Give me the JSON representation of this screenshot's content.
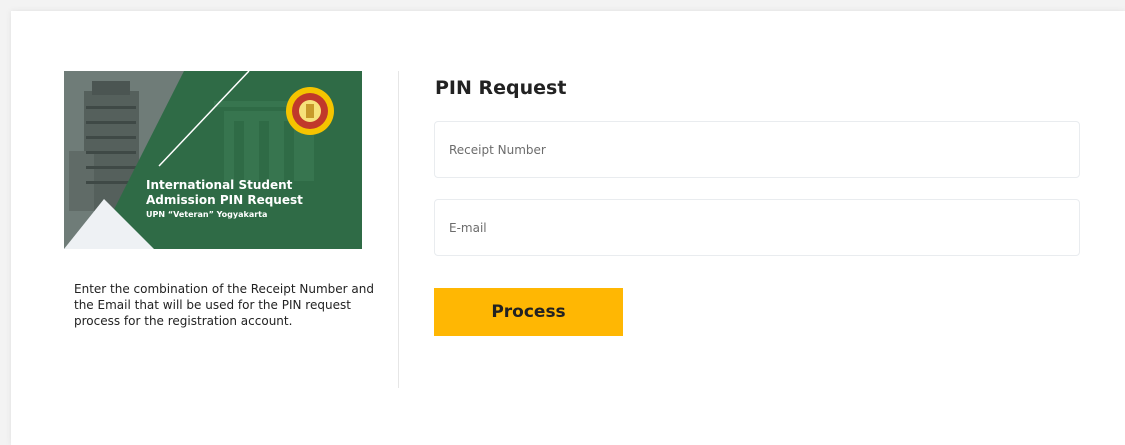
{
  "banner": {
    "title": "International Student Admission PIN Request",
    "subtitle": "UPN “Veteran” Yogyakarta"
  },
  "description": "Enter the combination of the Receipt Number and the Email that will be used for the PIN request process for the registration account.",
  "form": {
    "title": "PIN Request",
    "receipt_placeholder": "Receipt Number",
    "email_placeholder": "E-mail",
    "process_label": "Process"
  },
  "colors": {
    "accent": "#ffb703",
    "banner_green": "#2f6b46"
  }
}
